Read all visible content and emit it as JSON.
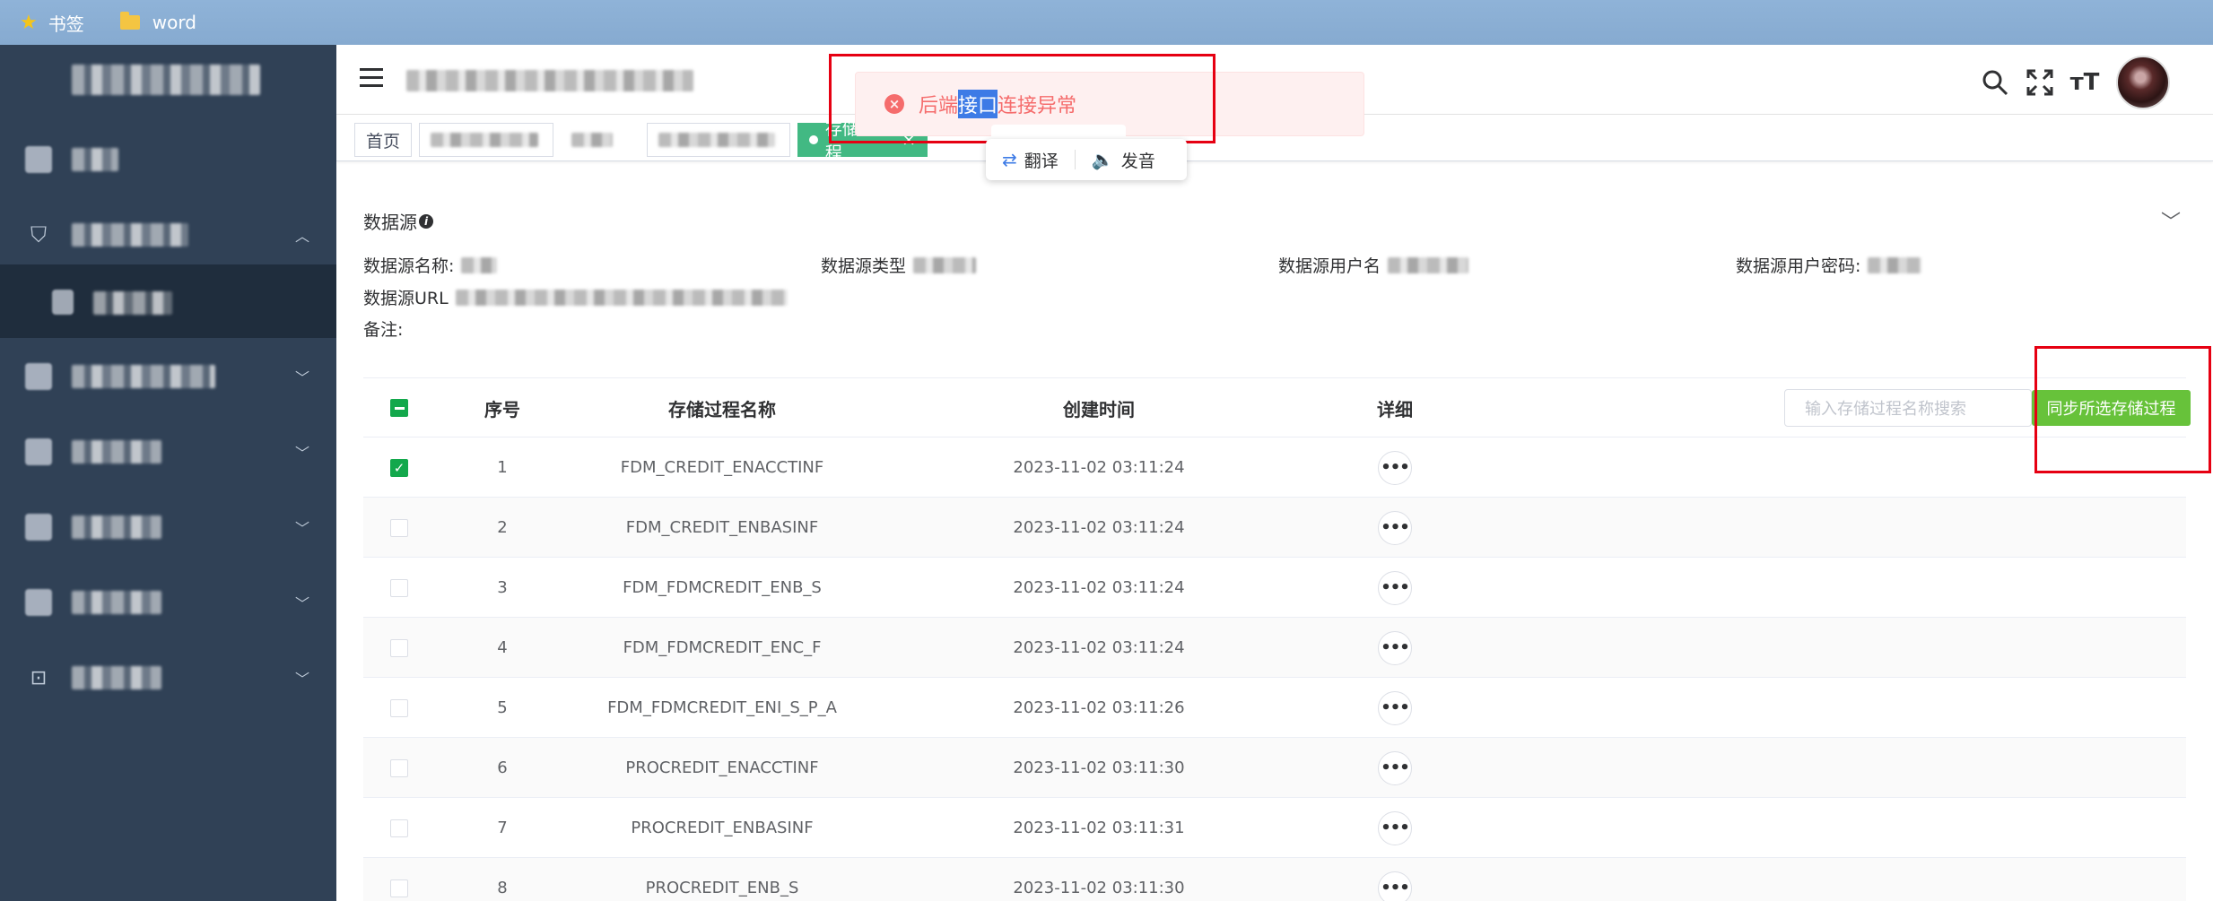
{
  "browser": {
    "bookmarks": [
      {
        "label": "书签",
        "icon": "star-icon"
      },
      {
        "label": "word",
        "icon": "folder-icon"
      }
    ]
  },
  "tags": {
    "home": "首页",
    "active_label": "存储过程",
    "active_close": "×"
  },
  "toast": {
    "text_before": "后端",
    "text_highlight": "接口",
    "text_after": "连接异常",
    "icon": "error-circle-icon"
  },
  "translate_popup": {
    "translate": "翻译",
    "pronounce": "发音"
  },
  "datasource": {
    "title": "数据源",
    "name_label": "数据源名称:",
    "type_label": "数据源类型",
    "user_label": "数据源用户名",
    "password_label": "数据源用户密码:",
    "url_label": "数据源URL",
    "remark_label": "备注:"
  },
  "table": {
    "headers": {
      "index": "序号",
      "name": "存储过程名称",
      "created": "创建时间",
      "detail": "详细"
    },
    "search_placeholder": "输入存储过程名称搜索",
    "sync_button": "同步所选存储过程",
    "rows": [
      {
        "index": "1",
        "name": "FDM_CREDIT_ENACCTINF",
        "created": "2023-11-02 03:11:24",
        "checked": true
      },
      {
        "index": "2",
        "name": "FDM_CREDIT_ENBASINF",
        "created": "2023-11-02 03:11:24",
        "checked": false
      },
      {
        "index": "3",
        "name": "FDM_FDMCREDIT_ENB_S",
        "created": "2023-11-02 03:11:24",
        "checked": false
      },
      {
        "index": "4",
        "name": "FDM_FDMCREDIT_ENC_F",
        "created": "2023-11-02 03:11:24",
        "checked": false
      },
      {
        "index": "5",
        "name": "FDM_FDMCREDIT_ENI_S_P_A",
        "created": "2023-11-02 03:11:26",
        "checked": false
      },
      {
        "index": "6",
        "name": "PROCREDIT_ENACCTINF",
        "created": "2023-11-02 03:11:30",
        "checked": false
      },
      {
        "index": "7",
        "name": "PROCREDIT_ENBASINF",
        "created": "2023-11-02 03:11:31",
        "checked": false
      },
      {
        "index": "8",
        "name": "PROCREDIT_ENB_S",
        "created": "2023-11-02 03:11:30",
        "checked": false
      }
    ]
  },
  "colors": {
    "sidebar": "#304156",
    "accent_green": "#67c23a",
    "error_red": "#f56c6c",
    "annotation_red": "#e60012"
  }
}
